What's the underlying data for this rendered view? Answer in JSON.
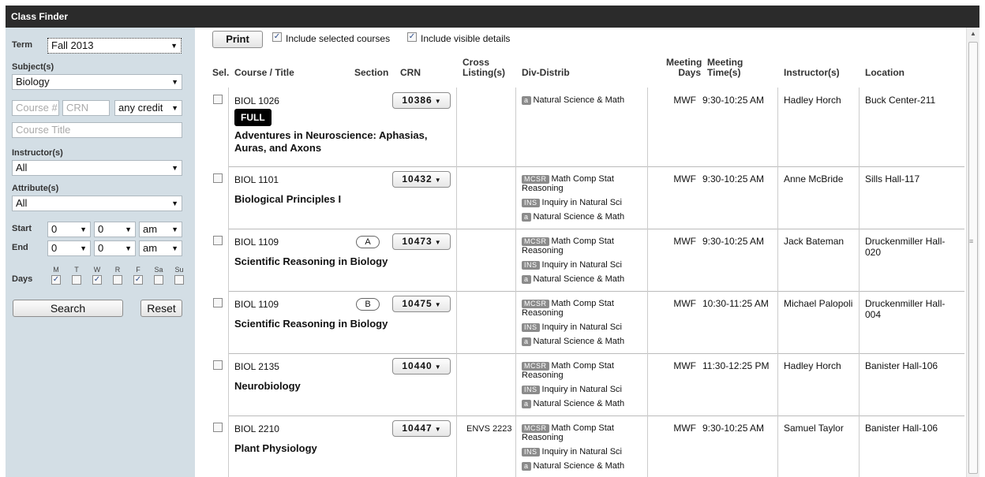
{
  "app": {
    "title": "Class Finder"
  },
  "sidebar": {
    "term_label": "Term",
    "term_value": "Fall 2013",
    "subject_label": "Subject(s)",
    "subject_value": "Biology",
    "course_num_placeholder": "Course #",
    "crn_placeholder": "CRN",
    "credit_value": "any credit",
    "course_title_placeholder": "Course Title",
    "instructor_label": "Instructor(s)",
    "instructor_value": "All",
    "attribute_label": "Attribute(s)",
    "attribute_value": "All",
    "start_label": "Start",
    "end_label": "End",
    "start_hour": "0",
    "start_min": "0",
    "start_ampm": "am",
    "end_hour": "0",
    "end_min": "0",
    "end_ampm": "am",
    "days_label": "Days",
    "days": [
      {
        "label": "M",
        "checked": true
      },
      {
        "label": "T",
        "checked": false
      },
      {
        "label": "W",
        "checked": true
      },
      {
        "label": "R",
        "checked": false
      },
      {
        "label": "F",
        "checked": true
      },
      {
        "label": "Sa",
        "checked": false
      },
      {
        "label": "Su",
        "checked": false
      }
    ],
    "search_label": "Search",
    "reset_label": "Reset"
  },
  "toolbar": {
    "print_label": "Print",
    "include_selected_label": "Include selected courses",
    "include_details_label": "Include visible details",
    "include_selected_checked": true,
    "include_details_checked": true
  },
  "columns": {
    "sel": "Sel.",
    "course": "Course / Title",
    "section": "Section",
    "crn": "CRN",
    "cross1": "Cross",
    "cross2": "Listing(s)",
    "div": "Div-Distrib",
    "days1": "Meeting",
    "days2": "Days",
    "time1": "Meeting",
    "time2": "Time(s)",
    "instructor": "Instructor(s)",
    "location": "Location"
  },
  "courses": [
    {
      "code": "BIOL 1026",
      "full": "FULL",
      "title": "Adventures in Neuroscience: Aphasias, Auras, and Axons",
      "section": "",
      "crn": "10386",
      "cross": "",
      "days": "MWF",
      "time": "9:30-10:25 AM",
      "instructor": "Hadley Horch",
      "location": "Buck Center-211",
      "distrib": [
        {
          "tag": "a",
          "text": "Natural Science & Math"
        }
      ]
    },
    {
      "code": "BIOL 1101",
      "full": "",
      "title": "Biological Principles I",
      "section": "",
      "crn": "10432",
      "cross": "",
      "days": "MWF",
      "time": "9:30-10:25 AM",
      "instructor": "Anne McBride",
      "location": "Sills Hall-117",
      "distrib": [
        {
          "tag": "MCSR",
          "text": "Math Comp Stat Reasoning"
        },
        {
          "tag": "INS",
          "text": "Inquiry in Natural Sci"
        },
        {
          "tag": "a",
          "text": "Natural Science & Math"
        }
      ]
    },
    {
      "code": "BIOL 1109",
      "full": "",
      "title": "Scientific Reasoning in Biology",
      "section": "A",
      "crn": "10473",
      "cross": "",
      "days": "MWF",
      "time": "9:30-10:25 AM",
      "instructor": "Jack Bateman",
      "location": "Druckenmiller Hall-020",
      "distrib": [
        {
          "tag": "MCSR",
          "text": "Math Comp Stat Reasoning"
        },
        {
          "tag": "INS",
          "text": "Inquiry in Natural Sci"
        },
        {
          "tag": "a",
          "text": "Natural Science & Math"
        }
      ]
    },
    {
      "code": "BIOL 1109",
      "full": "",
      "title": "Scientific Reasoning in Biology",
      "section": "B",
      "crn": "10475",
      "cross": "",
      "days": "MWF",
      "time": "10:30-11:25 AM",
      "instructor": "Michael Palopoli",
      "location": "Druckenmiller Hall-004",
      "distrib": [
        {
          "tag": "MCSR",
          "text": "Math Comp Stat Reasoning"
        },
        {
          "tag": "INS",
          "text": "Inquiry in Natural Sci"
        },
        {
          "tag": "a",
          "text": "Natural Science & Math"
        }
      ]
    },
    {
      "code": "BIOL 2135",
      "full": "",
      "title": "Neurobiology",
      "section": "",
      "crn": "10440",
      "cross": "",
      "days": "MWF",
      "time": "11:30-12:25 PM",
      "instructor": "Hadley Horch",
      "location": "Banister Hall-106",
      "distrib": [
        {
          "tag": "MCSR",
          "text": "Math Comp Stat Reasoning"
        },
        {
          "tag": "INS",
          "text": "Inquiry in Natural Sci"
        },
        {
          "tag": "a",
          "text": "Natural Science & Math"
        }
      ]
    },
    {
      "code": "BIOL 2210",
      "full": "",
      "title": "Plant Physiology",
      "section": "",
      "crn": "10447",
      "cross": "ENVS 2223",
      "days": "MWF",
      "time": "9:30-10:25 AM",
      "instructor": "Samuel Taylor",
      "location": "Banister Hall-106",
      "distrib": [
        {
          "tag": "MCSR",
          "text": "Math Comp Stat Reasoning"
        },
        {
          "tag": "INS",
          "text": "Inquiry in Natural Sci"
        },
        {
          "tag": "a",
          "text": "Natural Science & Math"
        }
      ]
    }
  ]
}
